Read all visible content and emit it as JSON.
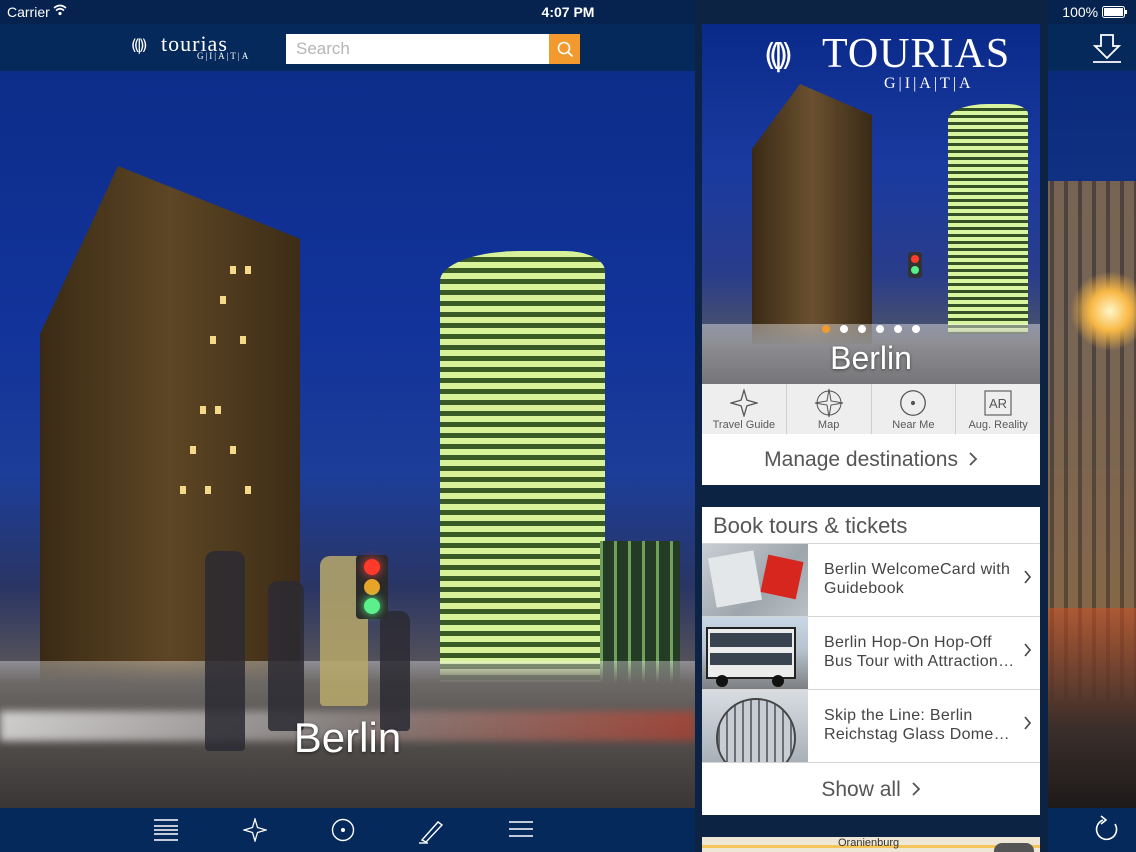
{
  "status_bar": {
    "carrier": "Carrier",
    "time": "4:07 PM",
    "battery": "100%"
  },
  "header": {
    "logo_name": "tourias",
    "logo_sub": "G|I|A|T|A",
    "search_placeholder": "Search"
  },
  "main": {
    "city_title": "Berlin"
  },
  "panel": {
    "logo_name": "TOURIAS",
    "logo_sub": "G|I|A|T|A",
    "city_title": "Berlin",
    "carousel_pages": 6,
    "carousel_active": 1,
    "quick_actions": [
      {
        "label": "Travel Guide",
        "icon": "star-outline-icon"
      },
      {
        "label": "Map",
        "icon": "compass-rose-icon"
      },
      {
        "label": "Near Me",
        "icon": "target-icon"
      },
      {
        "label": "Aug. Reality",
        "icon": "ar-icon",
        "badge": "AR"
      }
    ],
    "manage_label": "Manage destinations",
    "tours_title": "Book tours & tickets",
    "tours": [
      {
        "title": "Berlin WelcomeCard with Guidebook"
      },
      {
        "title": "Berlin Hop-On Hop-Off Bus Tour with Attraction…"
      },
      {
        "title": "Skip the Line: Berlin Reichstag Glass Dome…"
      }
    ],
    "show_all_label": "Show all",
    "map_label": "Oranienburg"
  },
  "bottom_bar": {
    "icons": [
      "list-icon",
      "star-outline-icon",
      "target-icon",
      "pen-icon",
      "menu-icon"
    ],
    "right_icon": "refresh-icon"
  },
  "colors": {
    "nav_bg": "#06295c",
    "accent": "#f39a2e",
    "text_gray": "#555555"
  }
}
